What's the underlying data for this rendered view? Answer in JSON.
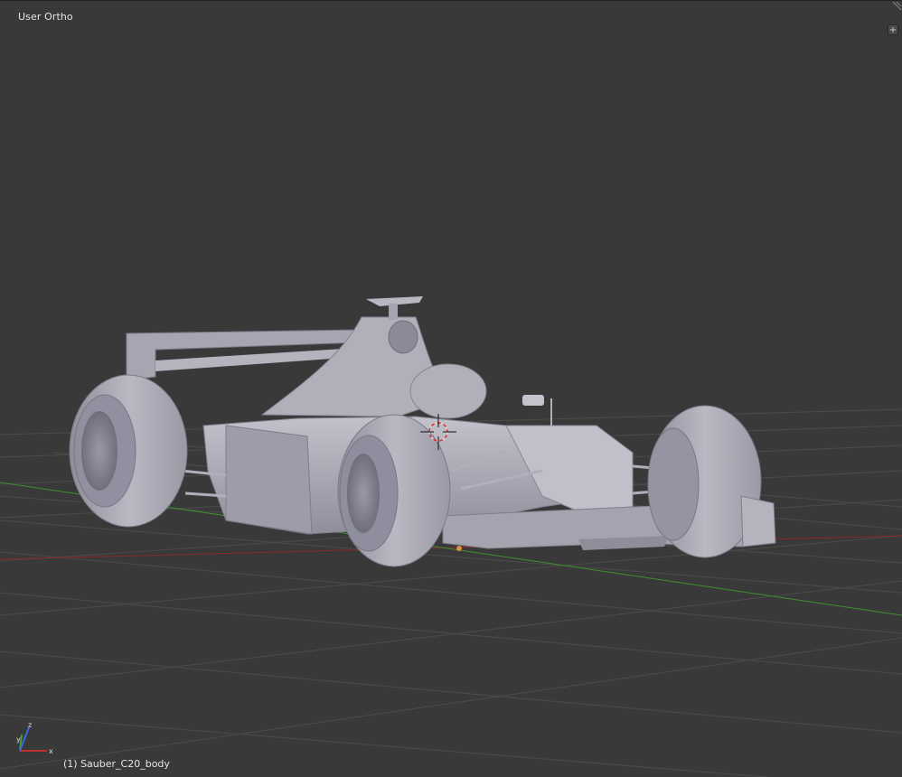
{
  "viewport": {
    "view_name": "User Ortho",
    "active_object_label": "(1) Sauber_C20_body",
    "background_color": "#393939",
    "grid_color": "#4b4b4b",
    "x_axis_color": "#8a2a2a",
    "y_axis_color": "#3f8f2f"
  },
  "widgets": {
    "add_region_icon": "plus-icon",
    "split_corner_icon": "corner-split-icon",
    "cursor_icon": "3d-cursor-icon",
    "axis_gizmo": {
      "x_label": "x",
      "y_label": "y",
      "z_label": "z"
    }
  },
  "model": {
    "name": "Sauber_C20_body",
    "shading_color": "#a8a8b4"
  }
}
